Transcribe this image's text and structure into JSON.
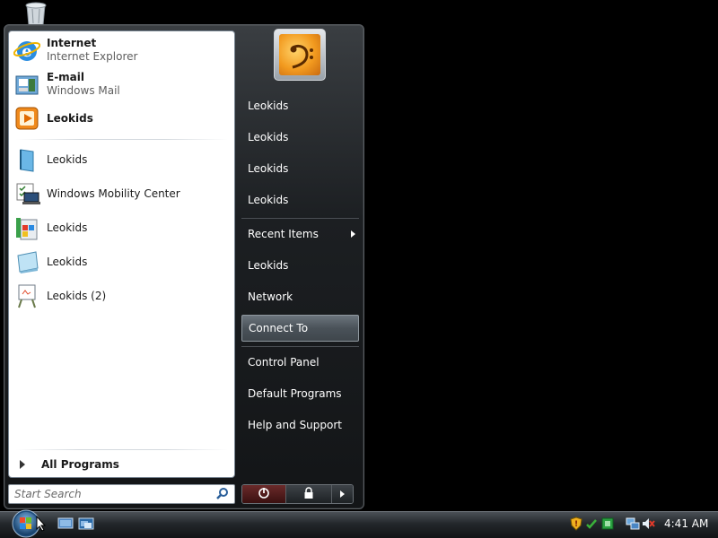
{
  "left_pane": {
    "pinned": [
      {
        "title": "Internet",
        "subtitle": "Internet Explorer",
        "icon": "internet-explorer-icon"
      },
      {
        "title": "E-mail",
        "subtitle": "Windows Mail",
        "icon": "windows-mail-icon"
      },
      {
        "title": "Leokids",
        "icon": "media-player-icon"
      }
    ],
    "recent": [
      {
        "title": "Leokids",
        "icon": "book-icon"
      },
      {
        "title": "Windows Mobility Center",
        "icon": "mobility-center-icon"
      },
      {
        "title": "Leokids",
        "icon": "paint-icon"
      },
      {
        "title": "Leokids",
        "icon": "notebook-icon"
      },
      {
        "title": "Leokids (2)",
        "icon": "easel-icon"
      }
    ],
    "all_programs": "All Programs"
  },
  "search": {
    "placeholder": "Start Search",
    "icon": "search-icon"
  },
  "right_pane": {
    "items": [
      {
        "label": "Leokids"
      },
      {
        "label": "Leokids"
      },
      {
        "label": "Leokids"
      },
      {
        "label": "Leokids"
      },
      {
        "label": "Recent Items",
        "submenu": true
      },
      {
        "label": "Leokids"
      },
      {
        "label": "Network"
      },
      {
        "label": "Connect To",
        "selected": true
      },
      {
        "label": "Control Panel"
      },
      {
        "label": "Default Programs"
      },
      {
        "label": "Help and Support"
      }
    ]
  },
  "power": {
    "power_icon": "power-icon",
    "lock_icon": "lock-icon",
    "more_icon": "arrow-right-icon"
  },
  "taskbar": {
    "clock": "4:41 AM",
    "quick_launch": [
      "show-desktop-icon",
      "switch-windows-icon"
    ],
    "tray": [
      "security-shield-icon",
      "network-sync-icon",
      "media-icon",
      "network-icon",
      "volume-muted-icon"
    ]
  },
  "colors": {
    "selected_item": "#4a5259",
    "menu_bg": "#1c1f22"
  }
}
